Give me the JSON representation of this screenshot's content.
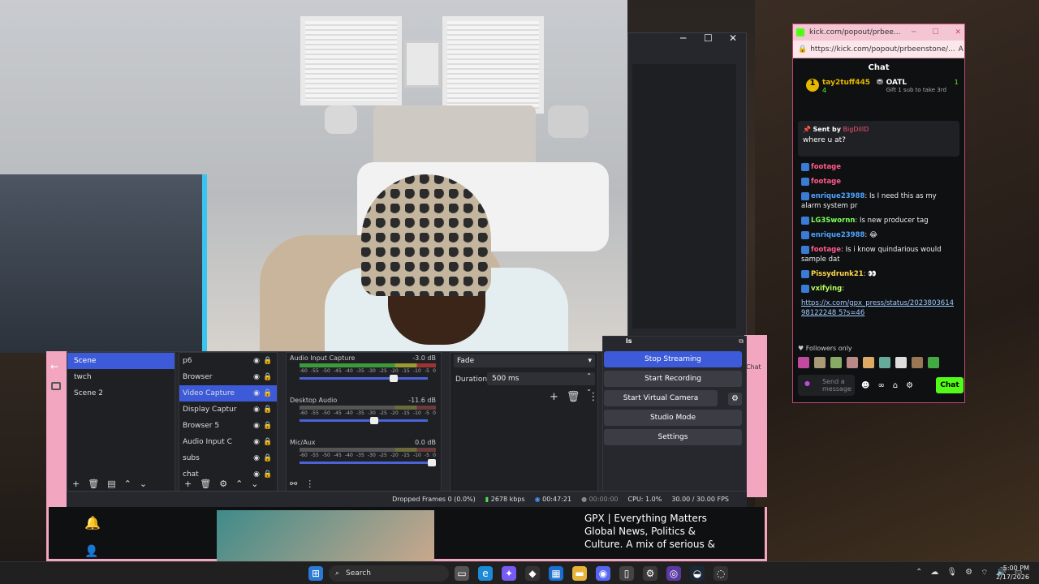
{
  "obs": {
    "scenes": [
      {
        "label": "Scene",
        "selected": true
      },
      {
        "label": "twch",
        "selected": false
      },
      {
        "label": "Scene 2",
        "selected": false
      }
    ],
    "sources": [
      {
        "label": "p6",
        "selected": false
      },
      {
        "label": "Browser",
        "selected": false
      },
      {
        "label": "Video Capture",
        "selected": true
      },
      {
        "label": "Display Captur",
        "selected": false
      },
      {
        "label": "Browser 5",
        "selected": false
      },
      {
        "label": "Audio Input C",
        "selected": false
      },
      {
        "label": "subs",
        "selected": false
      },
      {
        "label": "chat",
        "selected": false
      }
    ],
    "mixer": [
      {
        "name": "Audio Input Capture",
        "db": "-3.0 dB",
        "level": 0.7
      },
      {
        "name": "Desktop Audio",
        "db": "-11.6 dB",
        "level": 0.55
      },
      {
        "name": "Mic/Aux",
        "db": "0.0 dB",
        "level": 1.0
      }
    ],
    "meter_scale": [
      "-60",
      "-55",
      "-50",
      "-45",
      "-40",
      "-35",
      "-30",
      "-25",
      "-20",
      "-15",
      "-10",
      "-5",
      "0"
    ],
    "transition": {
      "type": "Fade",
      "duration_label": "Duration",
      "duration_value": "500 ms"
    },
    "controls": {
      "title": "ls",
      "buttons": [
        "Stop Streaming",
        "Start Recording",
        "Start Virtual Camera",
        "Studio Mode",
        "Settings"
      ]
    },
    "status": {
      "dropped": "Dropped Frames 0 (0.0%)",
      "bitrate": "2678 kbps",
      "stream_time": "00:47:21",
      "rec_time": "00:00:00",
      "cpu": "CPU: 1.0%",
      "fps": "30.00 / 30.00 FPS"
    }
  },
  "kick": {
    "url": "https://kick.com/popout/prbeenstone/...",
    "tab_url": "kick.com/popout/prbee...",
    "title": "Chat",
    "leader1": {
      "name": "tay2tuff445",
      "count": "4"
    },
    "leader2": {
      "name": "OATL",
      "count": "1",
      "note": "Gift 1 sub to take 3rd"
    },
    "pinned_by": "Sent by",
    "pinned_user": "BigDillD",
    "pinned_msg": "where u at?",
    "messages": [
      {
        "user": "footage",
        "text": "",
        "color": "#ff5a8a"
      },
      {
        "user": "footage",
        "text": "",
        "color": "#ff5a8a"
      },
      {
        "user": "enrique23988",
        "text": ": Is I need this as my alarm system pr",
        "color": "#4fa3ff"
      },
      {
        "user": "LG3Swornn",
        "text": ": Is new producer tag",
        "color": "#7dff5a"
      },
      {
        "user": "enrique23988",
        "text": ": 😂",
        "color": "#4fa3ff"
      },
      {
        "user": "footage",
        "text": ": Is i know quindarious would sample dat",
        "color": "#ff5a8a"
      },
      {
        "user": "Pissydrunk21",
        "text": ": 👀",
        "color": "#ffd84a"
      },
      {
        "user": "vxifying",
        "text": ":",
        "color": "#b6ff5a"
      }
    ],
    "link": "https://x.com/gpx_press/status/202380361498122248 5?s=46",
    "followers_only": "Followers only",
    "send_placeholder": "Send a message",
    "chat_button": "Chat"
  },
  "bottom": {
    "headline": "GPX | Everything Matters Global News, Politics & Culture. A mix of serious &"
  },
  "taskbar": {
    "search": "Search",
    "time": "5:00 PM",
    "date": "2/17/2026"
  },
  "icons": [
    "window-minimize-icon",
    "window-maximize-icon",
    "window-close-icon",
    "eye-icon",
    "lock-icon",
    "gear-icon",
    "bell-icon",
    "add-user-icon",
    "windows-start-icon",
    "search-icon",
    "wifi-icon",
    "volume-icon",
    "battery-icon"
  ]
}
